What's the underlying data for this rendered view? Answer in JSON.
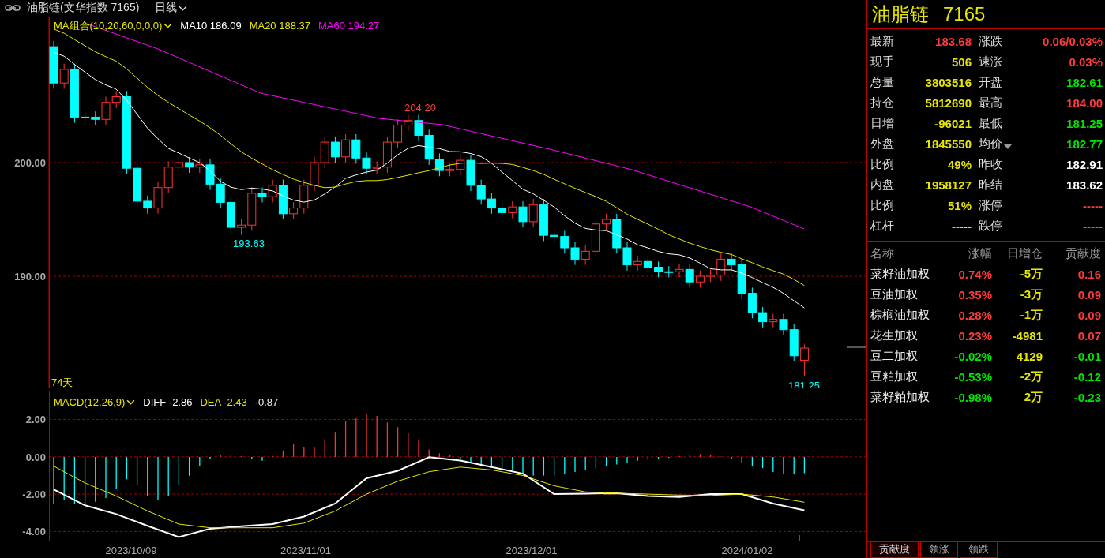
{
  "title_bar": {
    "name": "油脂链(文华指数 7165)",
    "period": "日线"
  },
  "ma_legend": {
    "label": "MA组合(10,20,60,0,0,0)",
    "items": [
      {
        "text": "MA10 186.09",
        "color": "#ffffff"
      },
      {
        "text": "MA20 188.37",
        "color": "#e6e600"
      },
      {
        "text": "MA60 194.27",
        "color": "#ff00ff"
      }
    ]
  },
  "price_chart": {
    "y_ticks": [
      "200.00",
      "190.00"
    ],
    "high_label": "204.20",
    "low_label": "193.63",
    "last_low_label": "181.25",
    "days": "74天"
  },
  "macd": {
    "label": "MACD(12,26,9)",
    "diff": "-2.86",
    "dea": "-2.43",
    "value": "-0.87",
    "chart_data": {
      "type": "line",
      "grid": true,
      "ylim": [
        -4.7,
        3.5
      ],
      "yticks": [
        {
          "value": 2,
          "label": "2.00"
        },
        {
          "value": 0,
          "label": "0.00"
        },
        {
          "value": -2,
          "label": "-2.00"
        },
        {
          "value": -4,
          "label": "-4.00"
        }
      ],
      "series": [
        {
          "name": "DIFF",
          "color": "#ffffff",
          "values": [
            -1.75,
            -2.6,
            -3.07,
            -3.7,
            -4.3,
            -3.85,
            -3.72,
            -3.6,
            -3.2,
            -2.5,
            -1.15,
            -0.75,
            -0.02,
            -0.2,
            -0.55,
            -0.9,
            -2.0,
            -1.97,
            -1.95,
            -2.1,
            -2.15,
            -2.0,
            -2.0,
            -2.5,
            -2.86
          ]
        },
        {
          "name": "DEA",
          "color": "#e6e600",
          "values": [
            -0.5,
            -1.4,
            -2.1,
            -2.9,
            -3.6,
            -3.8,
            -3.8,
            -3.8,
            -3.55,
            -2.9,
            -2.0,
            -1.3,
            -0.8,
            -0.55,
            -0.7,
            -1.0,
            -1.55,
            -1.88,
            -1.95,
            -2.0,
            -2.05,
            -2.07,
            -2.0,
            -2.15,
            -2.43
          ]
        }
      ]
    }
  },
  "x_axis": [
    "2023/10/09",
    "2023/11/01",
    "2023/12/01",
    "2024/01/02"
  ],
  "quote": {
    "name": "油脂链",
    "code": "7165",
    "left": [
      {
        "label": "最新",
        "value": "183.68",
        "color": "#ff3b3b"
      },
      {
        "label": "现手",
        "value": "506",
        "color": "#e6e600"
      },
      {
        "label": "总量",
        "value": "3803516",
        "color": "#e6e600"
      },
      {
        "label": "持仓",
        "value": "5812690",
        "color": "#e6e600"
      },
      {
        "label": "日增",
        "value": "-96021",
        "color": "#e6e600"
      },
      {
        "label": "外盘",
        "value": "1845550",
        "color": "#e6e600"
      },
      {
        "label": "比例",
        "value": "49%",
        "color": "#e6e600"
      },
      {
        "label": "内盘",
        "value": "1958127",
        "color": "#e6e600"
      },
      {
        "label": "比例",
        "value": "51%",
        "color": "#e6e600"
      },
      {
        "label": "杠杆",
        "value": "-----",
        "color": "#e6e600"
      }
    ],
    "right": [
      {
        "label": "涨跌",
        "value": "0.06/0.03%",
        "color": "#ff3b3b",
        "menu": false
      },
      {
        "label": "速涨",
        "value": "0.03%",
        "color": "#ff3b3b",
        "menu": false
      },
      {
        "label": "开盘",
        "value": "182.61",
        "color": "#00e600",
        "menu": false
      },
      {
        "label": "最高",
        "value": "184.00",
        "color": "#ff3b3b",
        "menu": false
      },
      {
        "label": "最低",
        "value": "181.25",
        "color": "#00e600",
        "menu": false
      },
      {
        "label": "均价",
        "value": "182.77",
        "color": "#00e600",
        "menu": true
      },
      {
        "label": "昨收",
        "value": "182.91",
        "color": "#ffffff",
        "menu": false
      },
      {
        "label": "昨结",
        "value": "183.62",
        "color": "#ffffff",
        "menu": false
      },
      {
        "label": "涨停",
        "value": "-----",
        "color": "#ff3b3b",
        "menu": false
      },
      {
        "label": "跌停",
        "value": "-----",
        "color": "#00e600",
        "menu": false
      }
    ]
  },
  "components": {
    "columns": [
      "名称",
      "涨幅",
      "日增仓",
      "贡献度"
    ],
    "rows": [
      {
        "name": "菜籽油加权",
        "change": "0.74%",
        "oi": "-5万",
        "contribution": "0.16",
        "color": "#ff3b3b"
      },
      {
        "name": "豆油加权",
        "change": "0.35%",
        "oi": "-3万",
        "contribution": "0.09",
        "color": "#ff3b3b"
      },
      {
        "name": "棕榈油加权",
        "change": "0.28%",
        "oi": "-1万",
        "contribution": "0.09",
        "color": "#ff3b3b"
      },
      {
        "name": "花生加权",
        "change": "0.23%",
        "oi": "-4981",
        "contribution": "0.07",
        "color": "#ff3b3b"
      },
      {
        "name": "豆二加权",
        "change": "-0.02%",
        "oi": "4129",
        "contribution": "-0.01",
        "color": "#00e600"
      },
      {
        "name": "豆粕加权",
        "change": "-0.53%",
        "oi": "-2万",
        "contribution": "-0.12",
        "color": "#00e600"
      },
      {
        "name": "菜籽粕加权",
        "change": "-0.98%",
        "oi": "2万",
        "contribution": "-0.23",
        "color": "#00e600"
      }
    ]
  },
  "tabs": [
    {
      "label": "贡献度",
      "selected": true
    },
    {
      "label": "领涨",
      "selected": false
    },
    {
      "label": "领跌",
      "selected": false
    }
  ]
}
